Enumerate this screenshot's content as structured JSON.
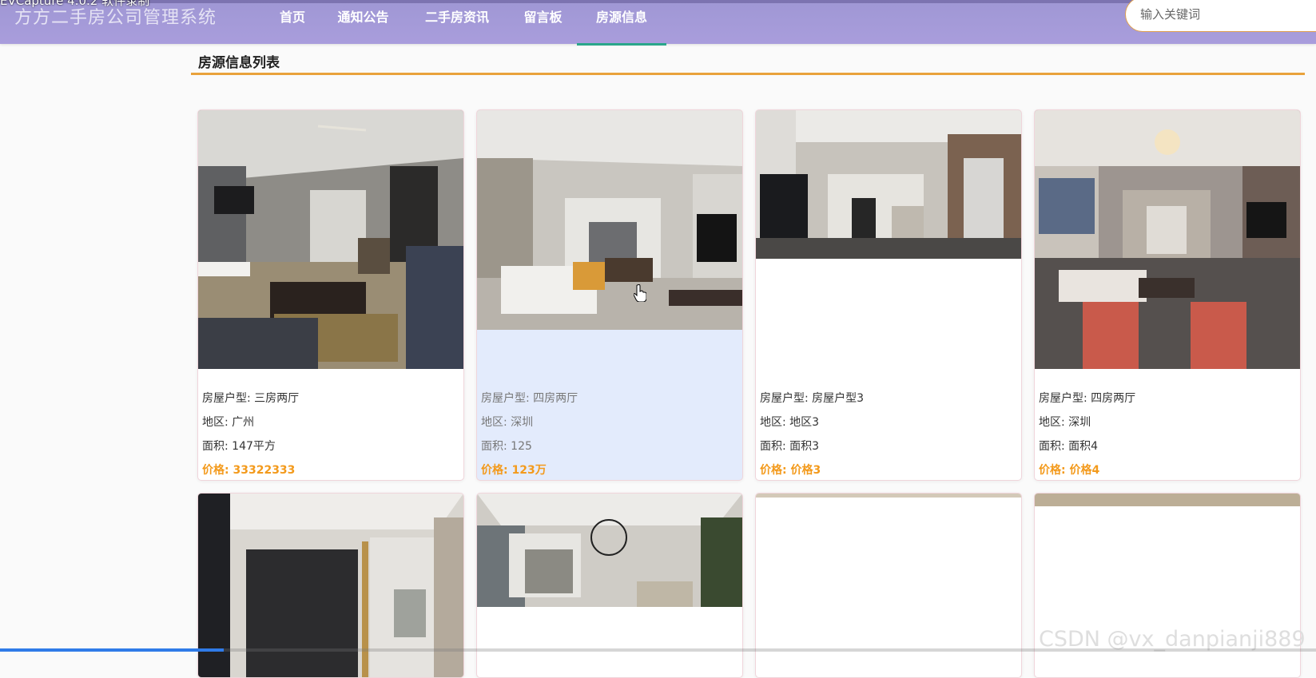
{
  "capture_overlay": {
    "text": "EVCapture 4.0.2 软件录制"
  },
  "header": {
    "title": "方方二手房公司管理系统",
    "nav": [
      {
        "label": "首页"
      },
      {
        "label": "通知公告"
      },
      {
        "label": "二手房资讯"
      },
      {
        "label": "留言板"
      },
      {
        "label": "房源信息",
        "active": true
      }
    ],
    "search": {
      "placeholder": "输入关键词",
      "value": ""
    }
  },
  "section": {
    "title": "房源信息列表"
  },
  "labels": {
    "house_type": "房屋户型: ",
    "region": "地区: ",
    "area": "面积: ",
    "price": "价格: "
  },
  "listings": [
    {
      "house_type": "三房两厅",
      "region": "广州",
      "area": "147平方",
      "price": "33322333"
    },
    {
      "house_type": "四房两厅",
      "region": "深圳",
      "area": "125",
      "price": "123万"
    },
    {
      "house_type": "房屋户型3",
      "region": "地区3",
      "area": "面积3",
      "price": "价格3"
    },
    {
      "house_type": "四房两厅",
      "region": "深圳",
      "area": "面积4",
      "price": "价格4"
    }
  ],
  "colors": {
    "header_bg": "#a99ddc",
    "active_underline": "#2aa68a",
    "section_line": "#e9a23b",
    "price": "#f39a1c",
    "hover_card": "#e3ebfc"
  },
  "watermark": {
    "text": "CSDN @vx_danpianji889"
  },
  "video_progress": {
    "fraction": 0.17
  }
}
